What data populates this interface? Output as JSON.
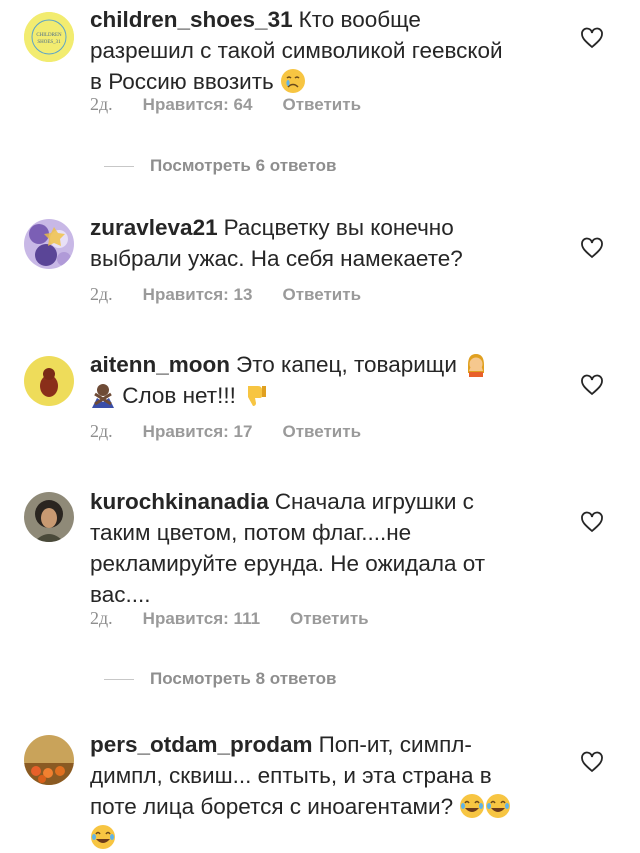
{
  "comments": [
    {
      "username": "children_shoes_31",
      "text": "Кто вообще разрешил с такой символикой геевской в Россию ввозить",
      "time": "2д.",
      "likes": "Нравится: 64",
      "reply": "Ответить",
      "avatar_text": "CHILDREN SHOES_31"
    },
    {
      "username": "zuravleva21",
      "text": "Расцветку вы конечно выбрали ужас. На себя намекаете?",
      "time": "2д.",
      "likes": "Нравится: 13",
      "reply": "Ответить"
    },
    {
      "username": "aitenn_moon",
      "text": "Это капец, товарищи",
      "text2": "Слов нет!!!",
      "time": "2д.",
      "likes": "Нравится: 17",
      "reply": "Ответить"
    },
    {
      "username": "kurochkinanadia",
      "text": "Сначала игрушки с таким цветом, потом флаг....не рекламируйте ерунда. Не ожидала от вас....",
      "time": "2д.",
      "likes": "Нравится: 111",
      "reply": "Ответить"
    },
    {
      "username": "pers_otdam_prodam",
      "text": "Поп-ит, симпл-димпл, сквиш... ептыть, и эта страна в поте лица борется с иноагентами?"
    }
  ],
  "view_replies": [
    "Посмотреть 6 ответов",
    "Посмотреть 8 ответов"
  ],
  "icons": {
    "heart": "heart-outline-icon",
    "crying": "crying-face-emoji",
    "facepalm": "woman-facepalming-emoji",
    "no_gesture": "person-gesturing-no-emoji",
    "thumbs_down": "thumbs-down-emoji",
    "laughing": "face-with-tears-of-joy-emoji"
  },
  "colors": {
    "text": "#262626",
    "secondary": "#8e8e8e"
  }
}
